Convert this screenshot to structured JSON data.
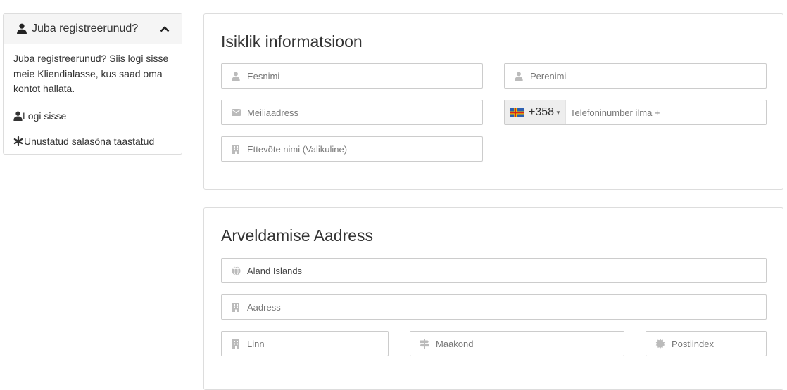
{
  "sidebar": {
    "header_title": "Juba registreerunud?",
    "body_text": "Juba registreerunud? Siis logi sisse meie Kliendialasse, kus saad oma kontot hallata.",
    "links": [
      {
        "label": "Logi sisse",
        "icon": "user-icon"
      },
      {
        "label": "Unustatud salasõna taastatud",
        "icon": "asterisk-icon"
      }
    ]
  },
  "personal": {
    "title": "Isiklik informatsioon",
    "first_name_placeholder": "Eesnimi",
    "last_name_placeholder": "Perenimi",
    "email_placeholder": "Meiliaadress",
    "phone_code": "+358",
    "phone_placeholder": "Telefoninumber ilma +",
    "company_placeholder": "Ettevõte nimi (Valikuline)",
    "flag": "aland-islands-flag"
  },
  "billing": {
    "title": "Arveldamise Aadress",
    "country_value": "Aland Islands",
    "address_placeholder": "Aadress",
    "city_placeholder": "Linn",
    "state_placeholder": "Maakond",
    "postcode_placeholder": "Postiindex"
  },
  "colors": {
    "border": "#cccccc",
    "placeholder": "#777777",
    "icon": "#bbbbbb",
    "panel_header_bg": "#f5f5f5"
  }
}
